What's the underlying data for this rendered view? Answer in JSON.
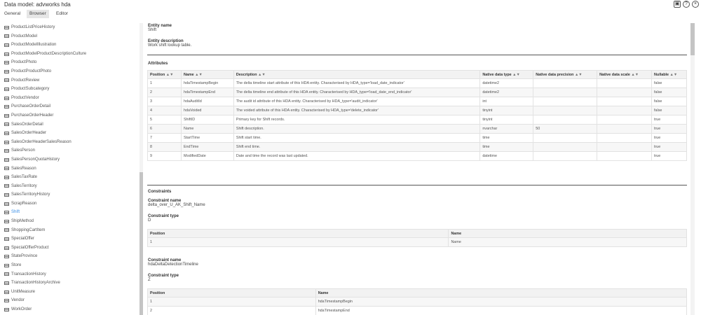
{
  "app": {
    "title": "Data model: advworks hda"
  },
  "window_icons": [
    "save-icon",
    "help-icon",
    "close-icon"
  ],
  "tabs": [
    {
      "label": "General"
    },
    {
      "label": "Browser"
    },
    {
      "label": "Editor"
    }
  ],
  "sidebar": {
    "selected": "Shift",
    "items": [
      "ProductListPriceHistory",
      "ProductModel",
      "ProductModelIllustration",
      "ProductModelProductDescriptionCulture",
      "ProductPhoto",
      "ProductProductPhoto",
      "ProductReview",
      "ProductSubcategory",
      "ProductVendor",
      "PurchaseOrderDetail",
      "PurchaseOrderHeader",
      "SalesOrderDetail",
      "SalesOrderHeader",
      "SalesOrderHeaderSalesReason",
      "SalesPerson",
      "SalesPersonQuotaHistory",
      "SalesReason",
      "SalesTaxRate",
      "SalesTerritory",
      "SalesTerritoryHistory",
      "ScrapReason",
      "Shift",
      "ShipMethod",
      "ShoppingCartItem",
      "SpecialOffer",
      "SpecialOfferProduct",
      "StateProvince",
      "Store",
      "TransactionHistory",
      "TransactionHistoryArchive",
      "UnitMeasure",
      "Vendor",
      "WorkOrder"
    ]
  },
  "entity": {
    "name_label": "Entity name",
    "name": "Shift",
    "desc_label": "Entity description",
    "description": "Work shift lookup table."
  },
  "attributes": {
    "title": "Attributes",
    "sort_glyph": "▲▼",
    "headers": [
      "Position",
      "Name",
      "Description",
      "Native data type",
      "Native data precision",
      "Native data scale",
      "Nullable"
    ],
    "rows": [
      [
        "1",
        "hdaTimestampBegin",
        "The delta timeline start attribute of this HDA entity. Characterised by HDA_type='load_date_indicator'",
        "datetime2",
        "",
        "",
        "false"
      ],
      [
        "2",
        "hdaTimestampEnd",
        "The delta timeline end attribute of this HDA entity. Characterised by HDA_type='load_date_end_indicator'",
        "datetime2",
        "",
        "",
        "false"
      ],
      [
        "3",
        "hdaAuditId",
        "The audit id attribute of this HDA entity. Characterised by HDA_type='audit_indicator'",
        "int",
        "",
        "",
        "false"
      ],
      [
        "4",
        "hdaVoided",
        "The voided attribute of this HDA entity. Characterised by HDA_type='delete_indicator'",
        "tinyint",
        "",
        "",
        "false"
      ],
      [
        "5",
        "ShiftID",
        "Primary key for Shift records.",
        "tinyint",
        "",
        "",
        "true"
      ],
      [
        "6",
        "Name",
        "Shift description.",
        "nvarchar",
        "50",
        "",
        "true"
      ],
      [
        "7",
        "StartTime",
        "Shift start time.",
        "time",
        "",
        "",
        "true"
      ],
      [
        "8",
        "EndTime",
        "Shift end time.",
        "time",
        "",
        "",
        "true"
      ],
      [
        "9",
        "ModifiedDate",
        "Date and time the record was last updated.",
        "datetime",
        "",
        "",
        "true"
      ]
    ]
  },
  "constraints": {
    "title": "Constraints",
    "name_label": "Constraint name",
    "type_label": "Constraint type",
    "headers": [
      "Position",
      "Name"
    ],
    "items": [
      {
        "name": "delta_over_U_AK_Shift_Name",
        "type": "D",
        "rows": [
          [
            "1",
            "Name"
          ]
        ]
      },
      {
        "name": "hdaDeltaDetectionTimeline",
        "type": "Z",
        "rows": [
          [
            "1",
            "hdaTimestampBegin"
          ],
          [
            "2",
            "hdaTimestampEnd"
          ]
        ]
      }
    ]
  }
}
